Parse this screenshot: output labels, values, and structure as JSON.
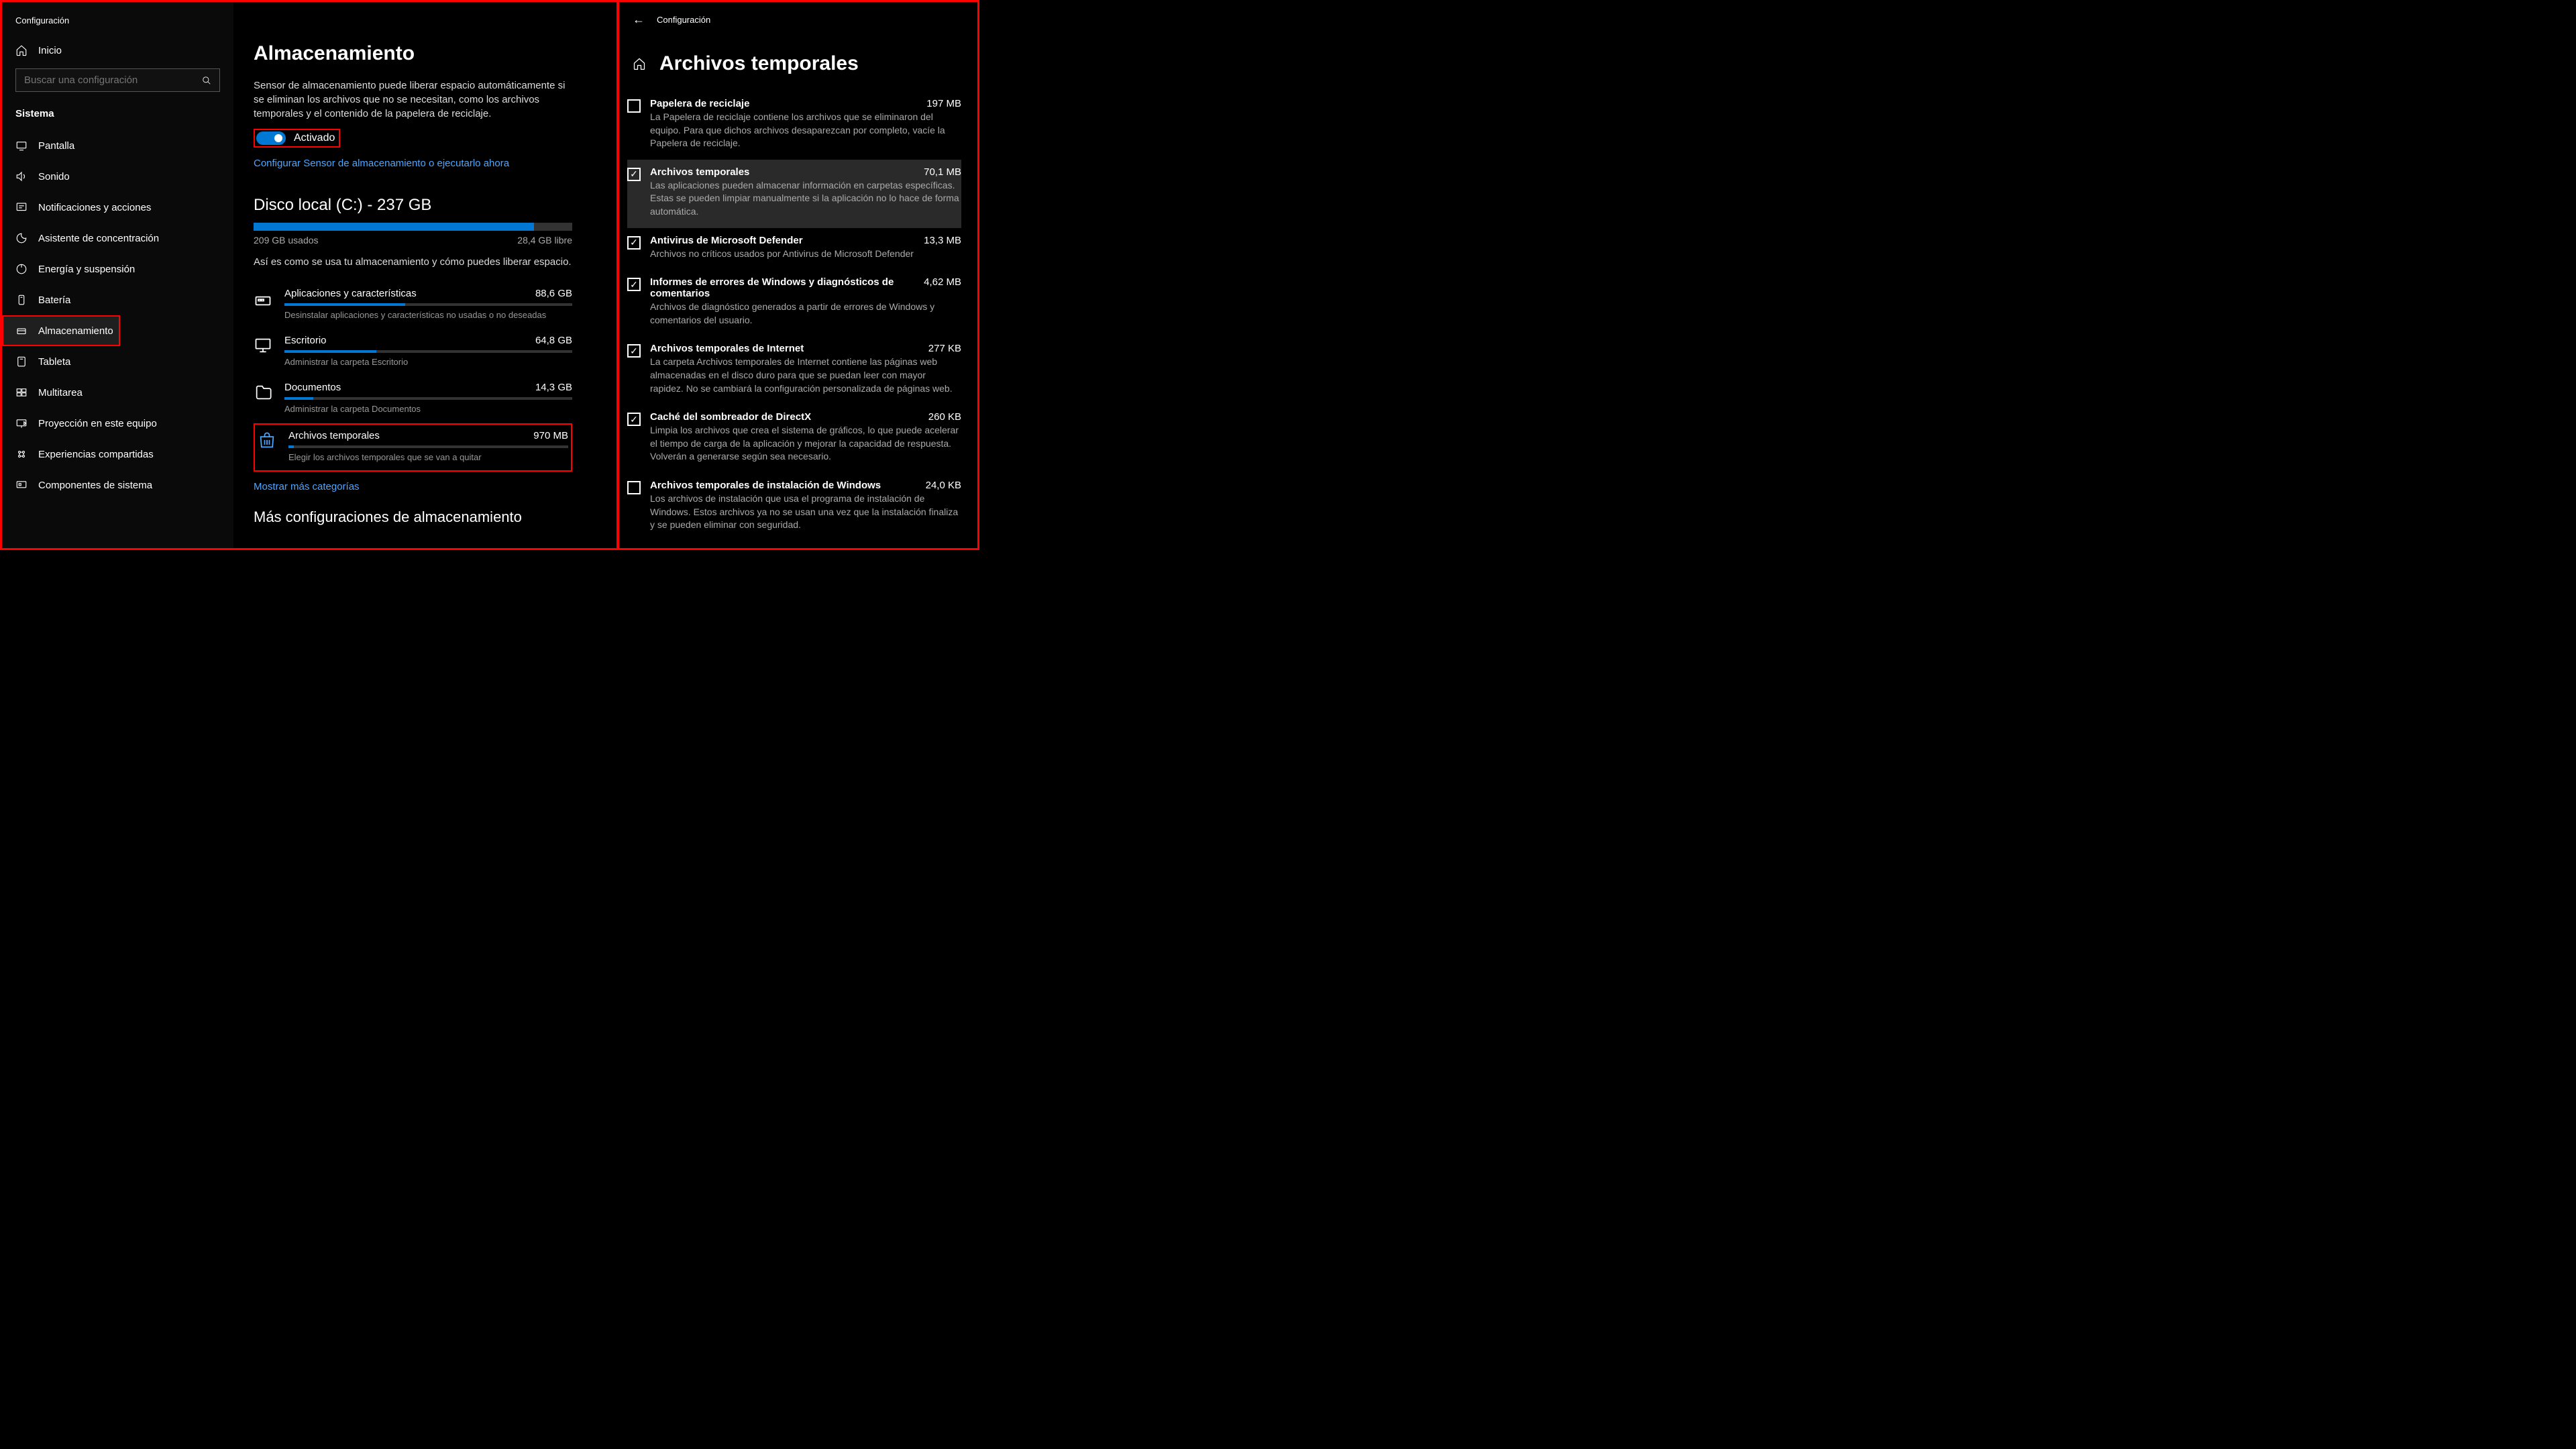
{
  "left": {
    "windowTitle": "Configuración",
    "homeLabel": "Inicio",
    "searchPlaceholder": "Buscar una configuración",
    "sectionLabel": "Sistema",
    "nav": [
      {
        "label": "Pantalla"
      },
      {
        "label": "Sonido"
      },
      {
        "label": "Notificaciones y acciones"
      },
      {
        "label": "Asistente de concentración"
      },
      {
        "label": "Energía y suspensión"
      },
      {
        "label": "Batería"
      },
      {
        "label": "Almacenamiento"
      },
      {
        "label": "Tableta"
      },
      {
        "label": "Multitarea"
      },
      {
        "label": "Proyección en este equipo"
      },
      {
        "label": "Experiencias compartidas"
      },
      {
        "label": "Componentes de sistema"
      }
    ]
  },
  "main": {
    "title": "Almacenamiento",
    "desc": "Sensor de almacenamiento puede liberar espacio automáticamente si se eliminan los archivos que no se necesitan, como los archivos temporales y el contenido de la papelera de reciclaje.",
    "toggleLabel": "Activado",
    "configLink": "Configurar Sensor de almacenamiento o ejecutarlo ahora",
    "diskTitle": "Disco local (C:) - 237 GB",
    "used": "209 GB usados",
    "free": "28,4 GB libre",
    "usageDesc": "Así es como se usa tu almacenamiento y cómo puedes liberar espacio.",
    "cats": [
      {
        "name": "Aplicaciones y características",
        "size": "88,6 GB",
        "sub": "Desinstalar aplicaciones y características no usadas o no deseadas",
        "fill": 42
      },
      {
        "name": "Escritorio",
        "size": "64,8 GB",
        "sub": "Administrar la carpeta Escritorio",
        "fill": 32
      },
      {
        "name": "Documentos",
        "size": "14,3 GB",
        "sub": "Administrar la carpeta Documentos",
        "fill": 10
      },
      {
        "name": "Archivos temporales",
        "size": "970 MB",
        "sub": "Elegir los archivos temporales que se van a quitar",
        "fill": 2
      }
    ],
    "moreLink": "Mostrar más categorías",
    "moreSection": "Más configuraciones de almacenamiento"
  },
  "right": {
    "windowTitle": "Configuración",
    "title": "Archivos temporales",
    "items": [
      {
        "name": "Papelera de reciclaje",
        "size": "197 MB",
        "checked": false,
        "desc": "La Papelera de reciclaje contiene los archivos que se eliminaron del equipo. Para que dichos archivos desaparezcan por completo, vacíe la Papelera de reciclaje."
      },
      {
        "name": "Archivos temporales",
        "size": "70,1 MB",
        "checked": true,
        "desc": "Las aplicaciones pueden almacenar información en carpetas específicas. Estas se pueden limpiar manualmente si la aplicación no lo hace de forma automática."
      },
      {
        "name": "Antivirus de Microsoft Defender",
        "size": "13,3 MB",
        "checked": true,
        "desc": "Archivos no críticos usados por Antivirus de Microsoft Defender"
      },
      {
        "name": "Informes de errores de Windows y diagnósticos de comentarios",
        "size": "4,62 MB",
        "checked": true,
        "desc": "Archivos de diagnóstico generados a partir de errores de Windows y comentarios del usuario."
      },
      {
        "name": "Archivos temporales de Internet",
        "size": "277 KB",
        "checked": true,
        "desc": "La carpeta Archivos temporales de Internet contiene las páginas web almacenadas en el disco duro para que se puedan leer con mayor rapidez. No se cambiará la configuración personalizada de páginas web."
      },
      {
        "name": "Caché del sombreador de DirectX",
        "size": "260 KB",
        "checked": true,
        "desc": "Limpia los archivos que crea el sistema de gráficos, lo que puede acelerar el tiempo de carga de la aplicación y mejorar la capacidad de respuesta. Volverán a generarse según sea necesario."
      },
      {
        "name": "Archivos temporales de instalación de Windows",
        "size": "24,0 KB",
        "checked": false,
        "desc": "Los archivos de instalación que usa el programa de instalación de Windows. Estos archivos ya no se usan una vez que la instalación finaliza y se pueden eliminar con seguridad."
      }
    ]
  }
}
